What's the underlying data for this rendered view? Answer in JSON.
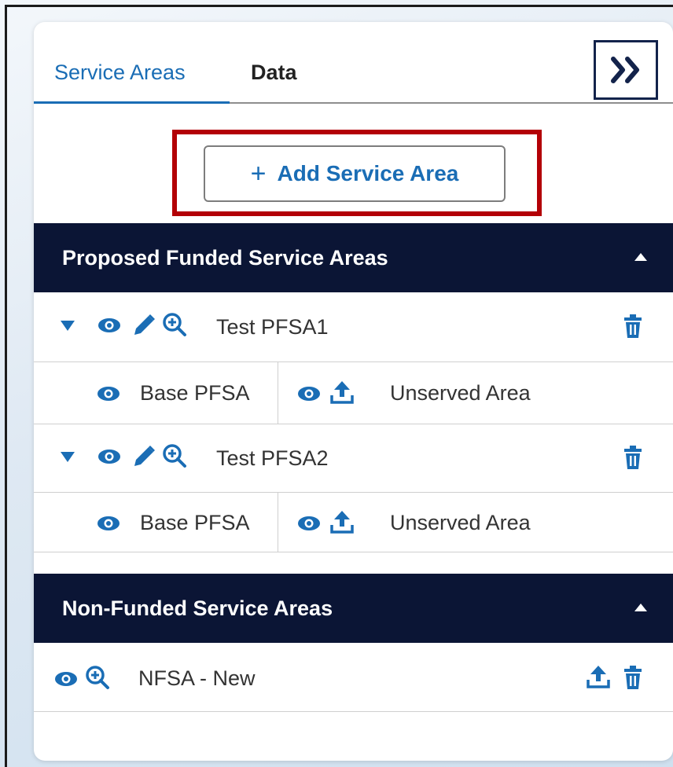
{
  "tabs": [
    {
      "label": "Service Areas",
      "active": true
    },
    {
      "label": "Data",
      "active": false
    }
  ],
  "collapse_button": {
    "label": "»",
    "icon": "double-chevron-right-icon"
  },
  "add_button": {
    "label": "Add Service Area",
    "icon": "plus-icon"
  },
  "sections": [
    {
      "title": "Proposed Funded Service Areas",
      "expanded": true,
      "items": [
        {
          "name": "Test PFSA1",
          "expanded": true,
          "sub_items": [
            {
              "label": "Base PFSA"
            },
            {
              "label": "Unserved Area"
            }
          ]
        },
        {
          "name": "Test PFSA2",
          "expanded": true,
          "sub_items": [
            {
              "label": "Base PFSA"
            },
            {
              "label": "Unserved Area"
            }
          ]
        }
      ]
    },
    {
      "title": "Non-Funded Service Areas",
      "expanded": true,
      "items": [
        {
          "name": "NFSA - New"
        }
      ]
    }
  ],
  "colors": {
    "accent": "#1a6db5",
    "header_bg": "#0b1535",
    "highlight": "#b30006",
    "icon": "#1a6db5"
  }
}
